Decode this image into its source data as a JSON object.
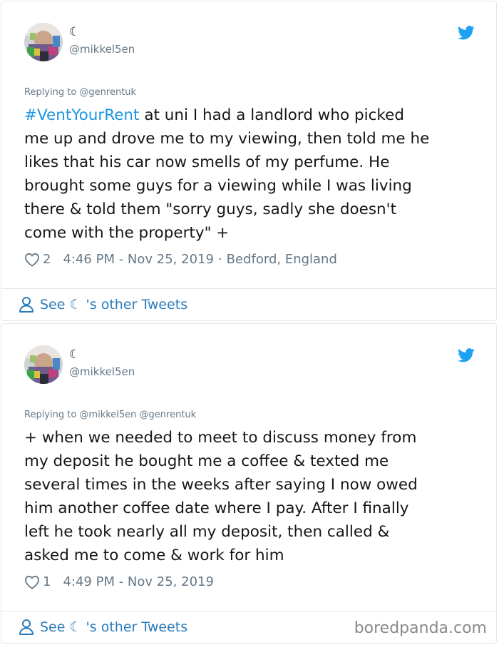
{
  "tweets": [
    {
      "display_name": "☾",
      "handle": "@mikkel5en",
      "reply_to": "Replying to @genrentuk",
      "hashtag": "#VentYourRent",
      "text": " at uni I had a landlord who picked\nme up and drove me to my viewing, then told me he\nlikes that his car now smells of my perfume. He\nbrought some guys for a viewing while I was living\nthere & told them \"sorry guys, sadly she doesn't\ncome with the property\" +",
      "likes": "2",
      "timestamp": "4:46 PM - Nov 25, 2019",
      "separator": "·",
      "location": "Bedford, England",
      "see_other": "See ☾ 's other Tweets",
      "avatar_icon": "avatar-photo",
      "bird_icon": "twitter-bird-icon"
    },
    {
      "display_name": "☾",
      "handle": "@mikkel5en",
      "reply_to": "Replying to @mikkel5en @genrentuk",
      "text": "+ when we needed to meet to discuss money from\nmy deposit he bought me a coffee & texted me\nseveral times in the weeks after saying I now owed\nhim another coffee date where I pay. After I finally\nleft he took nearly all my deposit, then called &\nasked me to come & work for him",
      "likes": "1",
      "timestamp": "4:49 PM - Nov 25, 2019",
      "see_other": "See ☾ 's other Tweets",
      "avatar_icon": "avatar-photo",
      "bird_icon": "twitter-bird-icon"
    }
  ],
  "watermark": "boredpanda.com",
  "colors": {
    "link": "#2b7bb9",
    "hashtag": "#1b95e0",
    "twitter_blue": "#1da1f2",
    "muted": "#657786",
    "text": "#14171a",
    "border": "#e1e8ed"
  }
}
